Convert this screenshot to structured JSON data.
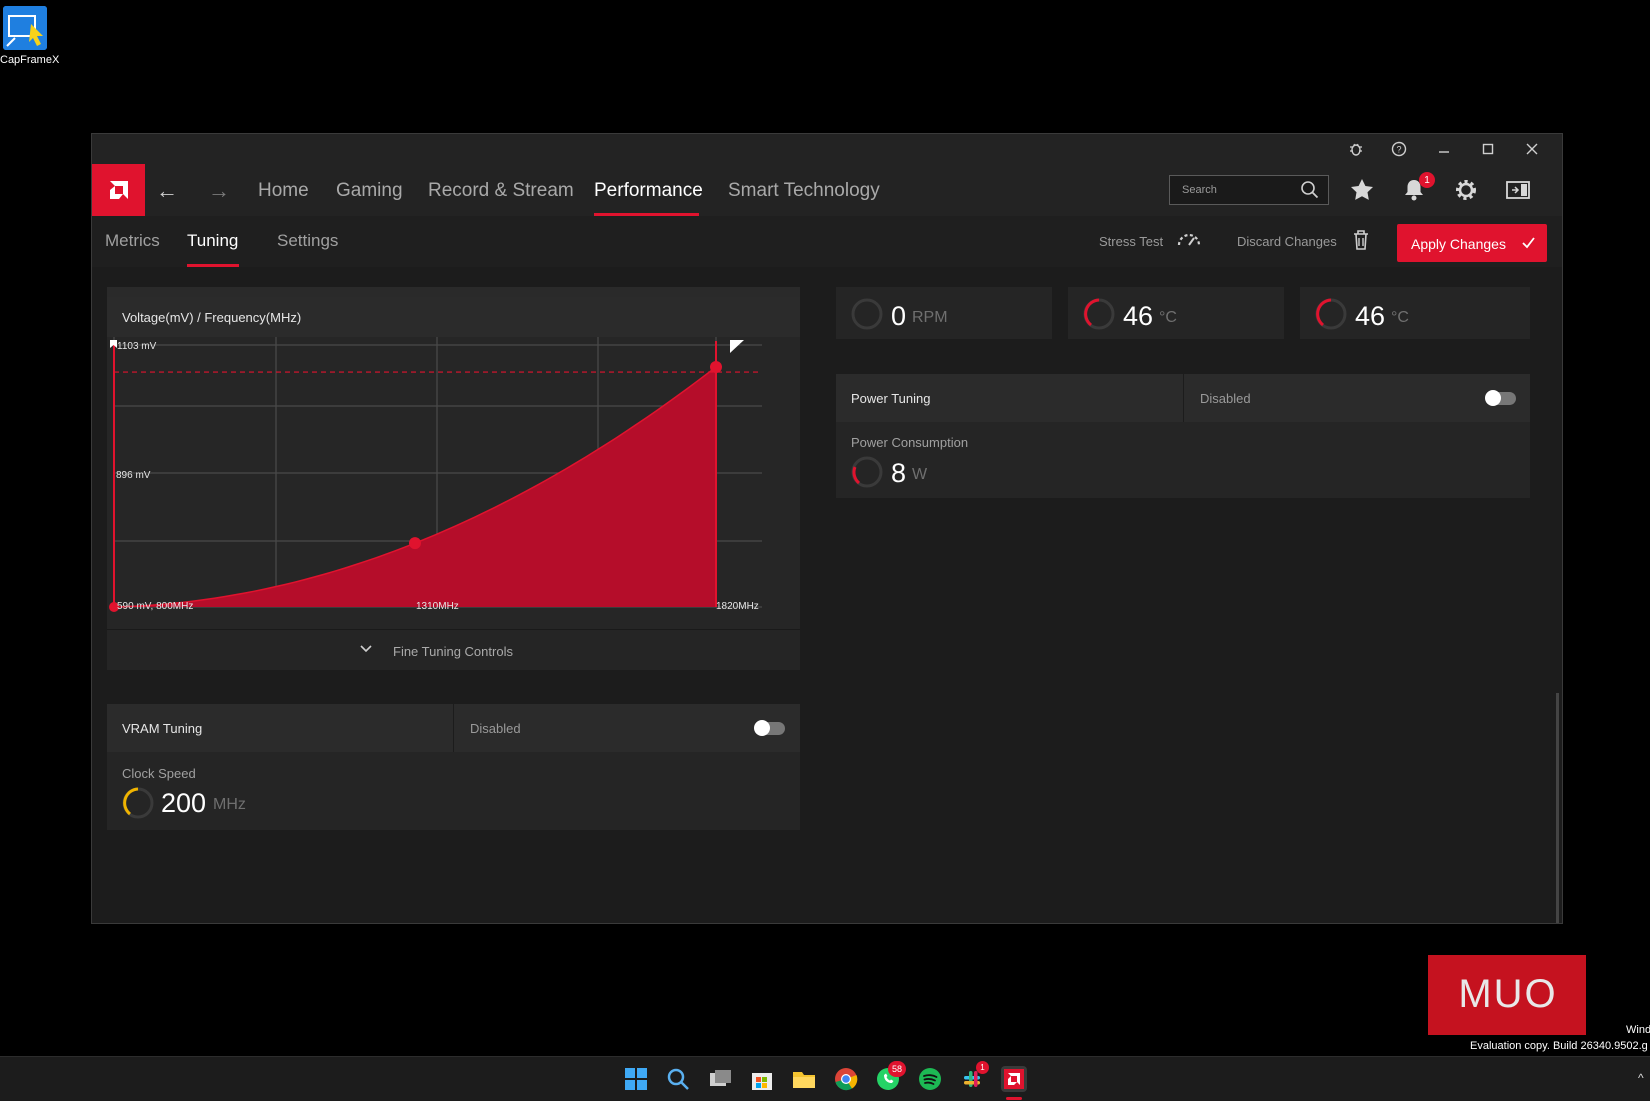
{
  "desktop": {
    "icon_label": "CapFrameX"
  },
  "nav": {
    "items": [
      "Home",
      "Gaming",
      "Record & Stream",
      "Performance",
      "Smart Technology"
    ],
    "active": "Performance",
    "search_placeholder": "Search",
    "notification_count": "1"
  },
  "subnav": {
    "items": [
      "Metrics",
      "Tuning",
      "Settings"
    ],
    "active": "Tuning",
    "stress_test": "Stress Test",
    "discard": "Discard Changes",
    "apply": "Apply Changes"
  },
  "vf_curve": {
    "title": "Voltage(mV) / Frequency(MHz)",
    "y_top_label": "1103 mV",
    "y_mid_label": "896 mV",
    "start_label": "590 mV, 800MHz",
    "mid_label": "1310MHz",
    "end_label": "1820MHz",
    "fine_tuning": "Fine Tuning Controls"
  },
  "chart_data": {
    "type": "area",
    "title": "Voltage(mV) / Frequency(MHz)",
    "xlabel": "",
    "ylabel": "",
    "x": [
      800,
      1310,
      1820
    ],
    "series": [
      {
        "values": [
          590,
          715,
          1060
        ]
      }
    ],
    "xlim": [
      800,
      1820
    ],
    "ylim": [
      590,
      1103
    ],
    "grid": true,
    "color": "#e0132e"
  },
  "vram": {
    "label": "VRAM Tuning",
    "status": "Disabled",
    "clock_label": "Clock Speed",
    "clock_value": "200",
    "clock_unit": "MHz"
  },
  "gauges": [
    {
      "value": "0",
      "unit": "RPM"
    },
    {
      "value": "46",
      "unit": "°C"
    },
    {
      "value": "46",
      "unit": "°C"
    }
  ],
  "power": {
    "label": "Power Tuning",
    "status": "Disabled",
    "consumption_label": "Power Consumption",
    "consumption_value": "8",
    "consumption_unit": "W"
  },
  "overlay": {
    "eval_line1": "Wind",
    "eval_line2": "Evaluation copy. Build 26340.9502.g",
    "muo_badge": "1",
    "whatsapp_badge": "58"
  },
  "colors": {
    "accent": "#e0132e",
    "clock_gauge": "#f0b400"
  }
}
